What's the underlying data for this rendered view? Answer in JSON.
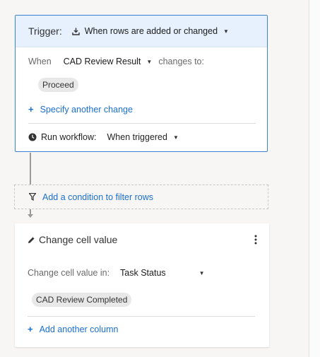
{
  "trigger": {
    "title": "Trigger:",
    "event_label": "When rows are added or changed",
    "when_label": "When",
    "column_value": "CAD Review Result",
    "changes_to_label": "changes to:",
    "value_chip": "Proceed",
    "specify_link": "Specify another change",
    "run_workflow_label": "Run workflow:",
    "run_workflow_value": "When triggered"
  },
  "filter": {
    "label": "Add a condition to filter rows"
  },
  "action": {
    "title": "Change cell value",
    "change_in_label": "Change cell value in:",
    "column_value": "Task Status",
    "value_chip": "CAD Review Completed",
    "add_column_link": "Add another column"
  },
  "icons": {
    "trigger_event": "row-add-icon",
    "run_workflow": "clock-icon",
    "filter": "funnel-icon",
    "action": "pencil-icon",
    "menu": "more-vertical-icon"
  },
  "colors": {
    "accent_link": "#1a6fcf",
    "trigger_border": "#3b82d6",
    "trigger_header_bg": "#e6f1fd"
  }
}
